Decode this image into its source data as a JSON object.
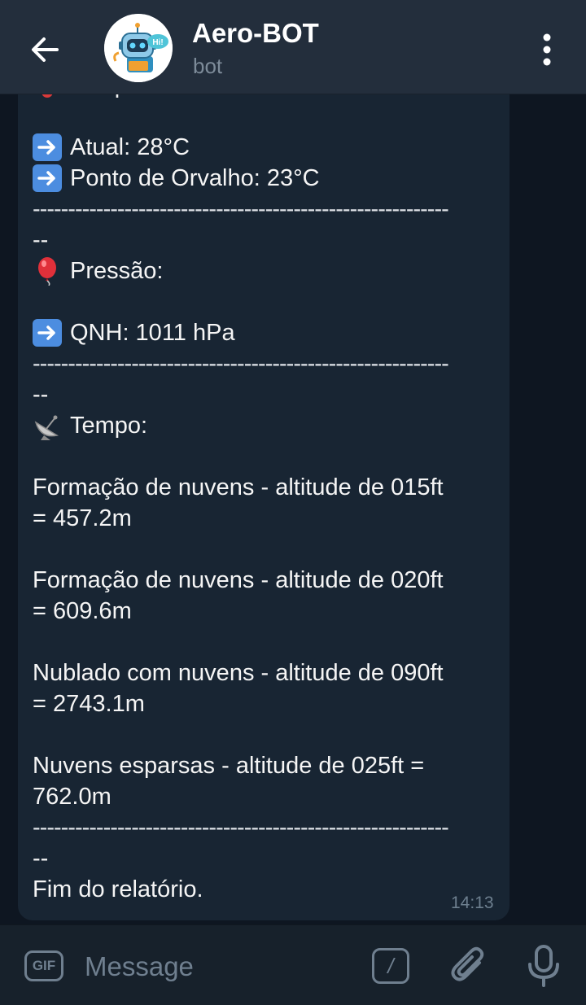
{
  "header": {
    "title": "Aero-BOT",
    "subtitle": "bot",
    "back_icon": "arrow-left-icon",
    "menu_icon": "more-vertical-icon",
    "avatar_badge": "Hi!"
  },
  "message": {
    "cut_header": "Temperatura:",
    "temp_current": "Atual: 28°C",
    "temp_dew": "Ponto de Orvalho: 23°C",
    "divider": "-----------------------------------------------------------",
    "divider_tail": "--",
    "pressure_title": "Pressão:",
    "pressure_qnh": "QNH: 1011 hPa",
    "weather_title": "Tempo:",
    "clouds": [
      {
        "line1": "Formação de nuvens - altitude de 015ft",
        "line2": "= 457.2m"
      },
      {
        "line1": "Formação de nuvens - altitude de 020ft",
        "line2": "= 609.6m"
      },
      {
        "line1": "Nublado com nuvens - altitude de 090ft",
        "line2": "= 2743.1m"
      },
      {
        "line1": "Nuvens esparsas - altitude de 025ft =",
        "line2": "762.0m"
      }
    ],
    "end_text": "Fim do relatório.",
    "time": "14:13"
  },
  "composer": {
    "gif_label": "GIF",
    "placeholder": "Message",
    "command_label": "/",
    "attach_icon": "paperclip-icon",
    "mic_icon": "microphone-icon"
  },
  "colors": {
    "header_bg": "#232e3c",
    "chat_bg": "#0e1621",
    "bubble_bg": "#182533",
    "accent": "#4c8de0",
    "muted": "#6f7f8f"
  }
}
